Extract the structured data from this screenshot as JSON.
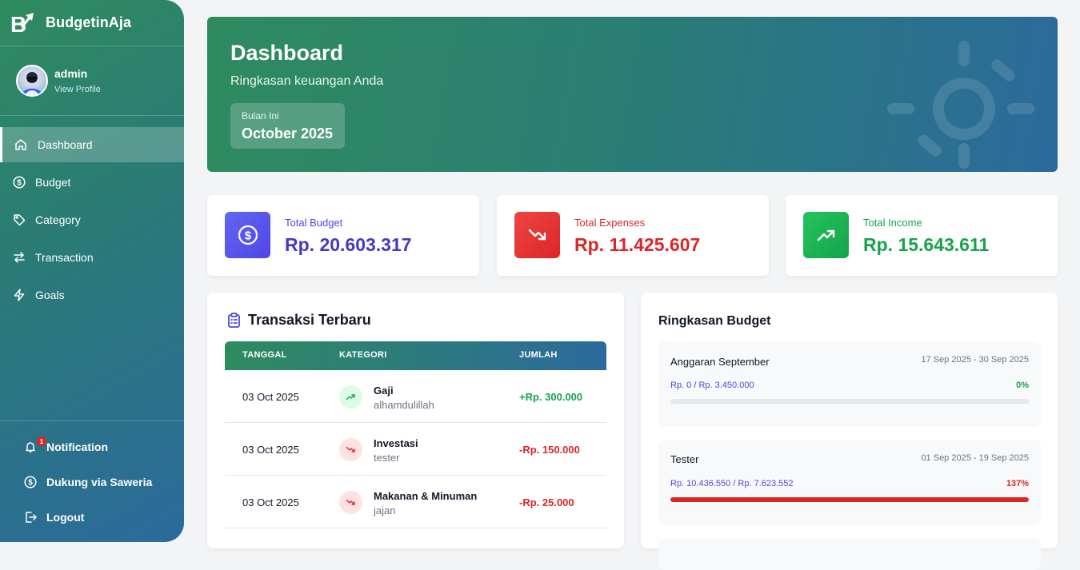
{
  "app": {
    "name": "BudgetinAja"
  },
  "profile": {
    "name": "admin",
    "link": "View Profile"
  },
  "nav": [
    {
      "label": "Dashboard",
      "icon": "home-icon",
      "active": true
    },
    {
      "label": "Budget",
      "icon": "dollar-circle-icon",
      "active": false
    },
    {
      "label": "Category",
      "icon": "tag-icon",
      "active": false
    },
    {
      "label": "Transaction",
      "icon": "transfer-arrows-icon",
      "active": false
    },
    {
      "label": "Goals",
      "icon": "lightning-icon",
      "active": false
    }
  ],
  "bottom_nav": {
    "notification": {
      "label": "Notification",
      "badge": "1"
    },
    "donate": {
      "label": "Dukung via Saweria"
    },
    "logout": {
      "label": "Logout"
    }
  },
  "hero": {
    "title": "Dashboard",
    "subtitle": "Ringkasan keuangan Anda",
    "period_label": "Bulan Ini",
    "period_value": "October 2025"
  },
  "stats": [
    {
      "label": "Total Budget",
      "value": "Rp. 20.603.317",
      "color": "#4338ca",
      "icon": "dollar-circle-icon"
    },
    {
      "label": "Total Expenses",
      "value": "Rp. 11.425.607",
      "color": "#dc2626",
      "icon": "trending-down-icon"
    },
    {
      "label": "Total Income",
      "value": "Rp. 15.643.611",
      "color": "#16a34a",
      "icon": "trending-up-icon"
    }
  ],
  "transactions": {
    "title": "Transaksi Terbaru",
    "columns": [
      "TANGGAL",
      "KATEGORI",
      "JUMLAH"
    ],
    "rows": [
      {
        "date": "03 Oct 2025",
        "category": "Gaji",
        "note": "alhamdulillah",
        "amount": "+Rp. 300.000",
        "type": "income"
      },
      {
        "date": "03 Oct 2025",
        "category": "Investasi",
        "note": "tester",
        "amount": "-Rp. 150.000",
        "type": "expense"
      },
      {
        "date": "03 Oct 2025",
        "category": "Makanan & Minuman",
        "note": "jajan",
        "amount": "-Rp. 25.000",
        "type": "expense"
      }
    ]
  },
  "budget_summary": {
    "title": "Ringkasan Budget",
    "items": [
      {
        "name": "Anggaran September",
        "dates": "17 Sep 2025 - 30 Sep 2025",
        "amount": "Rp. 0 / Rp. 3.450.000",
        "percent": "0%",
        "progress": 0,
        "status_color": "#16a34a"
      },
      {
        "name": "Tester",
        "dates": "01 Sep 2025 - 19 Sep 2025",
        "amount": "Rp. 10.436.550 / Rp. 7.623.552",
        "percent": "137%",
        "progress": 1,
        "status_color": "#dc2626"
      }
    ]
  }
}
